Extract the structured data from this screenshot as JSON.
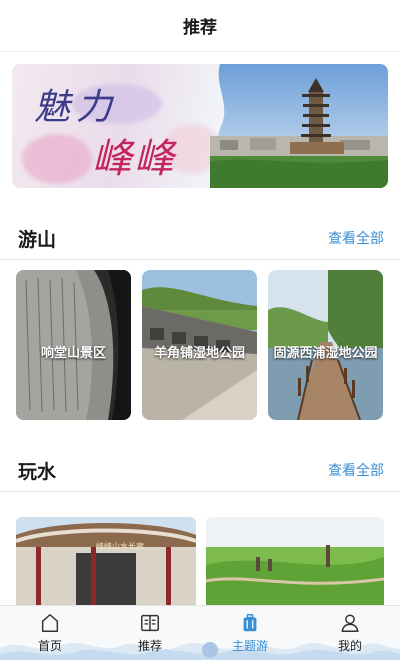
{
  "header": {
    "title": "推荐"
  },
  "banner": {
    "line1": "魅力",
    "line2": "峰峰"
  },
  "sections": {
    "mountain": {
      "title": "游山",
      "more": "查看全部",
      "cards": [
        {
          "label": "响堂山景区"
        },
        {
          "label": "羊角铺湿地公园"
        },
        {
          "label": "固源西浦湿地公园"
        }
      ]
    },
    "water": {
      "title": "玩水",
      "more": "查看全部",
      "sign_text": "峰峰山水长廊"
    }
  },
  "tabbar": {
    "active": "theme",
    "accent": "#3a8fd6",
    "items": [
      {
        "label": "首页",
        "icon": "home-icon"
      },
      {
        "label": "推荐",
        "icon": "book-icon"
      },
      {
        "label": "主题游",
        "icon": "suitcase-icon"
      },
      {
        "label": "我的",
        "icon": "user-icon"
      }
    ]
  }
}
